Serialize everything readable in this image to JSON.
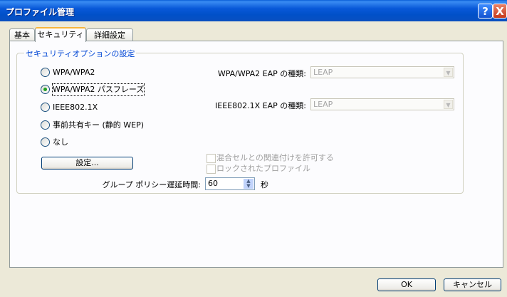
{
  "window": {
    "title": "プロファイル管理",
    "help_glyph": "?",
    "close_glyph": "X"
  },
  "tabs": [
    {
      "label": "基本"
    },
    {
      "label": "セキュリティ"
    },
    {
      "label": "詳細設定"
    }
  ],
  "security": {
    "group_title": "セキュリティオプションの設定",
    "options": [
      {
        "label": "WPA/WPA2",
        "checked": false
      },
      {
        "label": "WPA/WPA2 パスフレーズ",
        "checked": true
      },
      {
        "label": "IEEE802.1X",
        "checked": false
      },
      {
        "label": "事前共有キー (静的 WEP)",
        "checked": false
      },
      {
        "label": "なし",
        "checked": false
      }
    ],
    "wpa_eap_label": "WPA/WPA2 EAP の種類:",
    "wpa_eap_value": "LEAP",
    "ieee_eap_label": "IEEE802.1X EAP の種類:",
    "ieee_eap_value": "LEAP",
    "settings_button": "設定...",
    "mixed_cell_label": "混合セルとの関連付けを許可する",
    "locked_profile_label": "ロックされたプロファイル",
    "group_policy_label": "グループ ポリシー遅延時間:",
    "group_policy_value": "60",
    "seconds_label": "秒"
  },
  "footer": {
    "ok": "OK",
    "cancel": "キャンセル"
  }
}
